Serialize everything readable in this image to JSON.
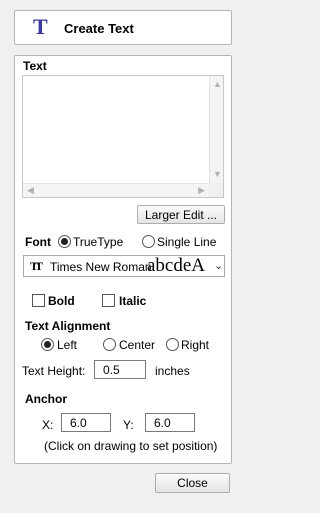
{
  "header": {
    "title": "Create Text",
    "icon": "text-tool-icon"
  },
  "text_section": {
    "label": "Text",
    "value": "",
    "larger_edit_label": "Larger Edit ..."
  },
  "font": {
    "label": "Font",
    "truetype_label": "TrueType",
    "single_line_label": "Single Line",
    "selected_mode": "TrueType",
    "family": "Times New Roman",
    "preview": "abcdeA",
    "bold_label": "Bold",
    "italic_label": "Italic"
  },
  "alignment": {
    "label": "Text Alignment",
    "left_label": "Left",
    "center_label": "Center",
    "right_label": "Right",
    "selected": "Left"
  },
  "height": {
    "label": "Text Height:",
    "value": "0.5",
    "unit": "inches"
  },
  "anchor": {
    "label": "Anchor",
    "x_label": "X:",
    "x_value": "6.0",
    "y_label": "Y:",
    "y_value": "6.0",
    "hint": "(Click on drawing to set position)"
  },
  "footer": {
    "close_label": "Close"
  }
}
